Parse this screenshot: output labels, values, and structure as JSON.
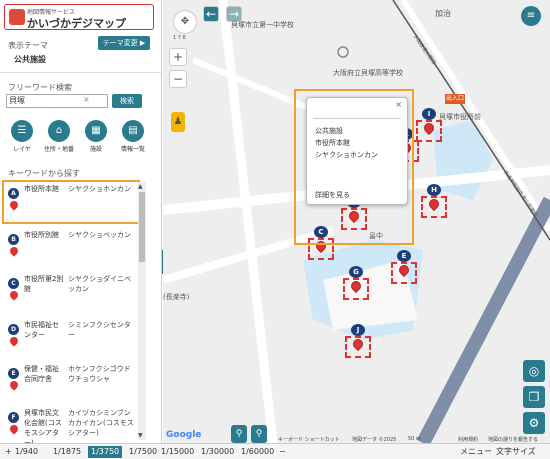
{
  "app": {
    "logo_small": "地図情報サービス",
    "logo_title": "かいづかデジマップ"
  },
  "theme": {
    "label": "表示テーマ",
    "change_button": "テーマ変更 ▶",
    "current": "公共施設"
  },
  "search": {
    "label": "フリーワード検索",
    "value": "貝塚",
    "button": "検索",
    "clear_icon": "×"
  },
  "tools": [
    {
      "label": "レイヤ",
      "icon": "list-icon",
      "glyph": "☰"
    },
    {
      "label": "住所・地番",
      "icon": "house-icon",
      "glyph": "⌂"
    },
    {
      "label": "施設",
      "icon": "building-icon",
      "glyph": "▦"
    },
    {
      "label": "情報一覧",
      "icon": "table-icon",
      "glyph": "▤"
    }
  ],
  "keyword": {
    "title": "キーワードから探す"
  },
  "list": [
    {
      "badge": "A",
      "name": "市役所本館",
      "kana": "シヤクショホンカン"
    },
    {
      "badge": "B",
      "name": "市役所別館",
      "kana": "シヤクショベッカン"
    },
    {
      "badge": "C",
      "name": "市役所第2別館",
      "kana": "シヤクショダイニベッカン"
    },
    {
      "badge": "D",
      "name": "市民福祉センター",
      "kana": "シミンフクシセンター"
    },
    {
      "badge": "E",
      "name": "保健・福祉合同庁舎",
      "kana": "ホケンフクシゴウドウチョウシャ"
    },
    {
      "badge": "F",
      "name": "貝塚市民文化会館(コスモスシアター)",
      "kana": "カイヅカシミンブンカカイカン(コスモスシアター)"
    }
  ],
  "popup": {
    "lines": [
      "公共施設",
      "市役所本館",
      "シヤクショホンカン"
    ],
    "detail": "詳細を見る",
    "close": "×"
  },
  "map": {
    "labels": {
      "school": "貝塚市立第一中学校",
      "high_school": "大阪府立貝塚高等学校",
      "kaji": "加治",
      "station": "貝塚市役所前",
      "exit": "出入口",
      "shimo": "畠中",
      "nagaizaka": "(長楽寺)",
      "route_label": "水間鉄道水間線",
      "road_label": "県道岸和田牛滝山貝塚線"
    },
    "markers": [
      "I",
      "A",
      "H",
      "B",
      "C",
      "G",
      "E",
      "J"
    ],
    "zoom_in": "+",
    "zoom_out": "−",
    "compass": "1 7 8"
  },
  "attribution": {
    "google": "Google",
    "keyboard": "キーボード ショートカット",
    "mapdata": "地図データ ©2025",
    "scale": "50 m",
    "terms": "利用規約",
    "report": "地図の誤りを報告する"
  },
  "scales": [
    "1/940",
    "1/1875",
    "1/3750",
    "1/7500",
    "1/15000",
    "1/30000",
    "1/60000"
  ],
  "active_scale": "1/3750",
  "footer": {
    "menu": "メニュー",
    "font": "文字サイズ"
  },
  "colors": {
    "accent": "#2a7b8e",
    "highlight": "#f0a030",
    "marker": "#1e3f7a"
  }
}
